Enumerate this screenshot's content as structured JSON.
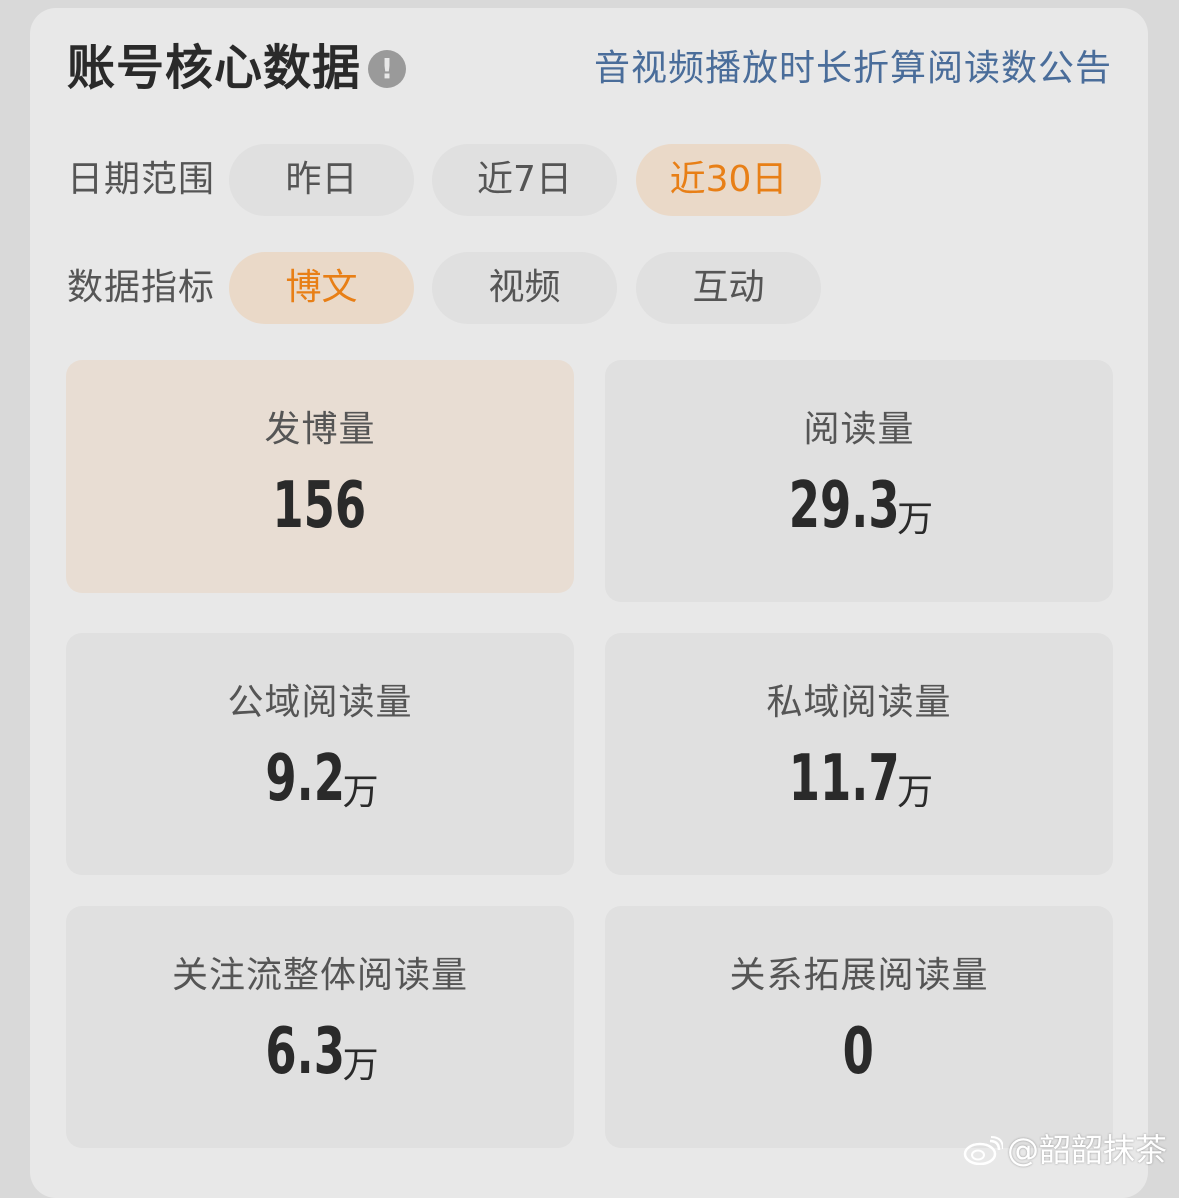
{
  "header": {
    "title": "账号核心数据",
    "info_icon_glyph": "!",
    "notice_link": "音视频播放时长折算阅读数公告"
  },
  "date_range": {
    "label": "日期范围",
    "options": [
      "昨日",
      "近7日",
      "近30日"
    ],
    "selected": "近30日"
  },
  "metrics_filter": {
    "label": "数据指标",
    "options": [
      "博文",
      "视频",
      "互动"
    ],
    "selected": "博文"
  },
  "metrics": [
    {
      "label": "发博量",
      "value": "156",
      "unit": ""
    },
    {
      "label": "阅读量",
      "value": "29.3",
      "unit": "万"
    },
    {
      "label": "公域阅读量",
      "value": "9.2",
      "unit": "万"
    },
    {
      "label": "私域阅读量",
      "value": "11.7",
      "unit": "万"
    },
    {
      "label": "关注流整体阅读量",
      "value": "6.3",
      "unit": "万"
    },
    {
      "label": "关系拓展阅读量",
      "value": "0",
      "unit": ""
    }
  ],
  "watermark": "@韶韶抹茶",
  "colors": {
    "accent": "#e87f16",
    "link": "#4a6d9a",
    "active_pill_bg": "#ead9c8"
  }
}
